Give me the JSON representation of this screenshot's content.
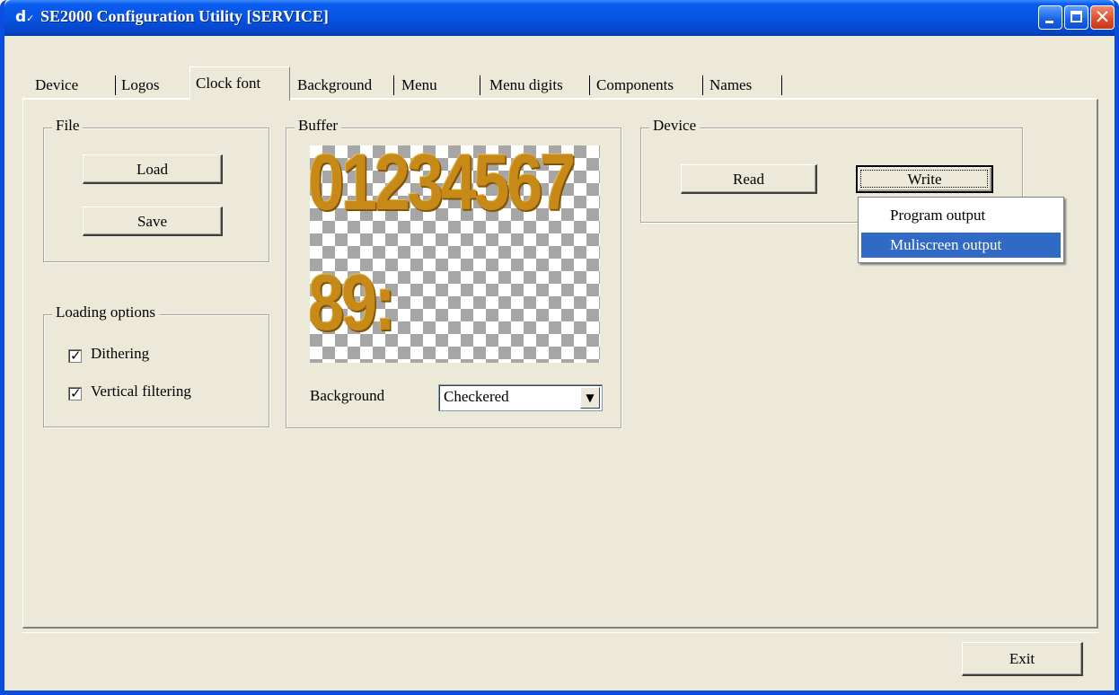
{
  "window": {
    "icon_glyph": "d",
    "icon_sub": "✓",
    "title": "SE2000 Configuration Utility [SERVICE]",
    "controls": [
      "minimize",
      "maximize",
      "close"
    ]
  },
  "tabs": [
    {
      "label": "Device",
      "active": false
    },
    {
      "label": "Logos",
      "active": false
    },
    {
      "label": "Clock font",
      "active": true
    },
    {
      "label": "Background",
      "active": false
    },
    {
      "label": "Menu",
      "active": false
    },
    {
      "label": "Menu digits",
      "active": false
    },
    {
      "label": "Components",
      "active": false
    },
    {
      "label": "Names",
      "active": false
    }
  ],
  "file_group": {
    "title": "File",
    "load_label": "Load",
    "save_label": "Save"
  },
  "loading_options": {
    "title": "Loading options",
    "options": [
      {
        "label": "Dithering",
        "checked": true
      },
      {
        "label": "Vertical filtering",
        "checked": true
      }
    ]
  },
  "buffer": {
    "title": "Buffer",
    "row1": "01234567",
    "row2": "89:",
    "background_label": "Background",
    "background_value": "Checkered"
  },
  "device_group": {
    "title": "Device",
    "read_label": "Read",
    "write_label": "Write"
  },
  "write_menu": {
    "items": [
      {
        "label": "Program output",
        "selected": false
      },
      {
        "label": "Muliscreen output",
        "selected": true
      }
    ]
  },
  "footer": {
    "exit_label": "Exit"
  },
  "colors": {
    "titlebar": "#0553e0",
    "face": "#ece9d8",
    "menu_highlight": "#316ac5",
    "digit_gold": "#c78a18"
  }
}
